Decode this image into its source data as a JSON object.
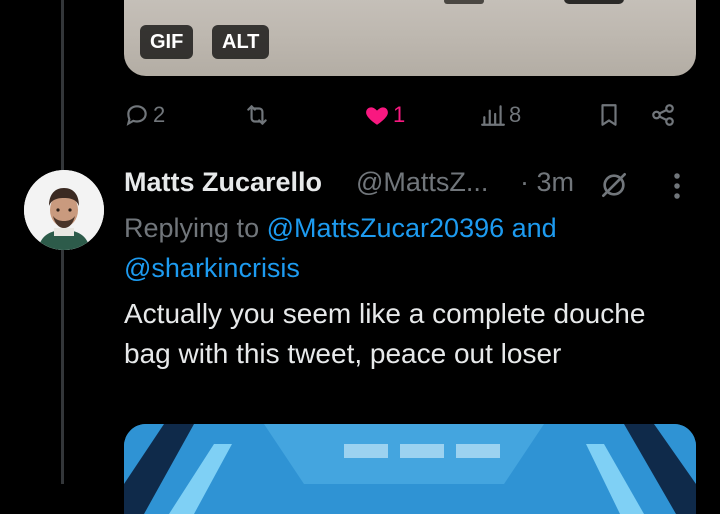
{
  "media_top": {
    "badges": [
      "GIF",
      "ALT"
    ]
  },
  "actions": {
    "reply_count": "2",
    "like_count": "1",
    "views_count": "8"
  },
  "tweet": {
    "author_name": "Matts Zucarello",
    "author_handle": "@MattsZ...",
    "time": "· 3m",
    "replying_prefix": "Replying to",
    "replying_mention_1": "@MattsZucar20396",
    "replying_and": "and",
    "replying_mention_2": "@sharkincrisis",
    "text": "Actually you seem like a complete douche bag with this tweet, peace out loser"
  },
  "colors": {
    "background": "#000000",
    "text": "#e7e9ea",
    "secondary": "#71767b",
    "link": "#1d9bf0",
    "like": "#f91880"
  }
}
